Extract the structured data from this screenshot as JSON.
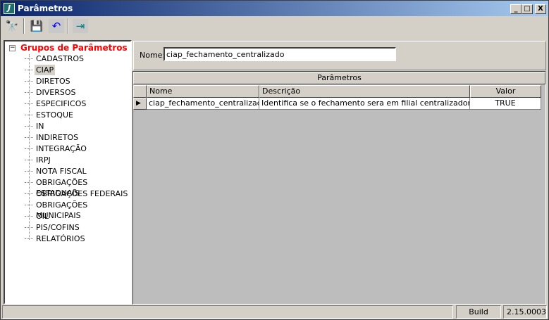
{
  "window": {
    "title": "Parâmetros",
    "controls": {
      "minimize": "_",
      "maximize": "□",
      "close": "X"
    }
  },
  "toolbar": {
    "icons": [
      "binoculars-icon",
      "save-icon",
      "undo-icon",
      "exit-door-icon"
    ]
  },
  "tree": {
    "root": "Grupos de Parâmetros",
    "expander": "−",
    "selected": "CIAP",
    "items": [
      "CADASTROS",
      "CIAP",
      "DIRETOS",
      "DIVERSOS",
      "ESPECIFICOS",
      "ESTOQUE",
      "IN",
      "INDIRETOS",
      "INTEGRAÇÃO",
      "IRPJ",
      "NOTA FISCAL",
      "OBRIGAÇÕES ESTADUAIS",
      "OBRIGAÇÕES FEDERAIS",
      "OBRIGAÇÕES MUNICIPAIS",
      "OIL",
      "PIS/COFINS",
      "RELATÓRIOS"
    ]
  },
  "filter": {
    "label": "Nome:",
    "value": "ciap_fechamento_centralizado"
  },
  "grid": {
    "title": "Parâmetros",
    "columns": [
      "Nome",
      "Descrição",
      "Valor"
    ],
    "rows": [
      {
        "nome": "ciap_fechamento_centralizado",
        "descricao": "Identifica se o fechamento sera em filial centralizadora (nao",
        "valor": "TRUE"
      }
    ]
  },
  "status": {
    "left": "",
    "build_label": "Build",
    "version": "2.15.0003"
  }
}
